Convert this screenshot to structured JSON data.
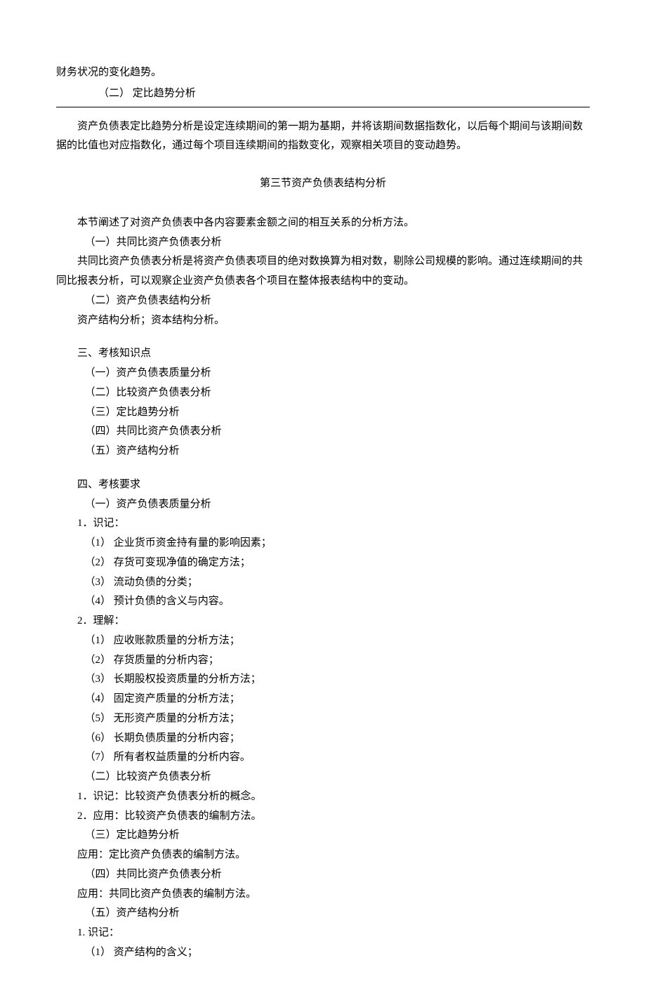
{
  "top_continuation": "财务状况的变化趋势。",
  "sec_2_header": "（二）   定比趋势分析",
  "sec_2_body": "资产负债表定比趋势分析是设定连续期间的第一期为基期，并将该期间数据指数化，以后每个期间与该期间数据的比值也对应指数化，通过每个项目连续期间的指数变化，观察相关项目的变动趋势。",
  "section3_title": "第三节资产负债表结构分析",
  "section3_intro": "本节阐述了对资产负债表中各内容要素金额之间的相互关系的分析方法。",
  "s3_item1_header": "（一）共同比资产负债表分析",
  "s3_item1_body": "共同比资产负债表分析是将资产负债表项目的绝对数换算为相对数，剔除公司规模的影响。通过连续期间的共同比报表分析，可以观察企业资产负债表各个项目在整体报表结构中的变动。",
  "s3_item2_header": "（二）资产负债表结构分析",
  "s3_item2_body": "资产结构分析；资本结构分析。",
  "kaohe_title": "三、考核知识点",
  "kaohe_items": {
    "i1": "（一）资产负债表质量分析",
    "i2": "（二）比较资产负债表分析",
    "i3": "（三）定比趋势分析",
    "i4": "（四）共同比资产负债表分析",
    "i5": "（五）资产结构分析"
  },
  "req_title": "四、考核要求",
  "req_1_header": "（一）资产负债表质量分析",
  "req_1_shiji": "1．识记：",
  "req_1_shiji_items": {
    "r1": "（1）  企业货币资金持有量的影响因素；",
    "r2": "（2）  存货可变现净值的确定方法；",
    "r3": "（3）  流动负债的分类；",
    "r4": "（4）  预计负债的含义与内容。"
  },
  "req_1_lijie": "2．理解：",
  "req_1_lijie_items": {
    "r1": "（1）  应收账款质量的分析方法；",
    "r2": "（2）  存货质量的分析内容；",
    "r3": "（3）  长期股权投资质量的分析方法；",
    "r4": "（4）  固定资产质量的分析方法；",
    "r5": "（5）  无形资产质量的分析方法；",
    "r6": "（6）  长期负债质量的分析内容；",
    "r7": "（7）  所有者权益质量的分析内容。"
  },
  "req_2_header": "（二）比较资产负债表分析",
  "req_2_shiji": "1．识记：比较资产负债表分析的概念。",
  "req_2_yingyong": "2．应用：比较资产负债表的编制方法。",
  "req_3_header": "（三）定比趋势分析",
  "req_3_yingyong": "应用：定比资产负债表的编制方法。",
  "req_4_header": "（四）共同比资产负债表分析",
  "req_4_yingyong": "应用：共同比资产负债表的编制方法。",
  "req_5_header": "（五）资产结构分析",
  "req_5_shiji": "1. 识记：",
  "req_5_shiji_items": {
    "r1": "（1）  资产结构的含义；"
  }
}
